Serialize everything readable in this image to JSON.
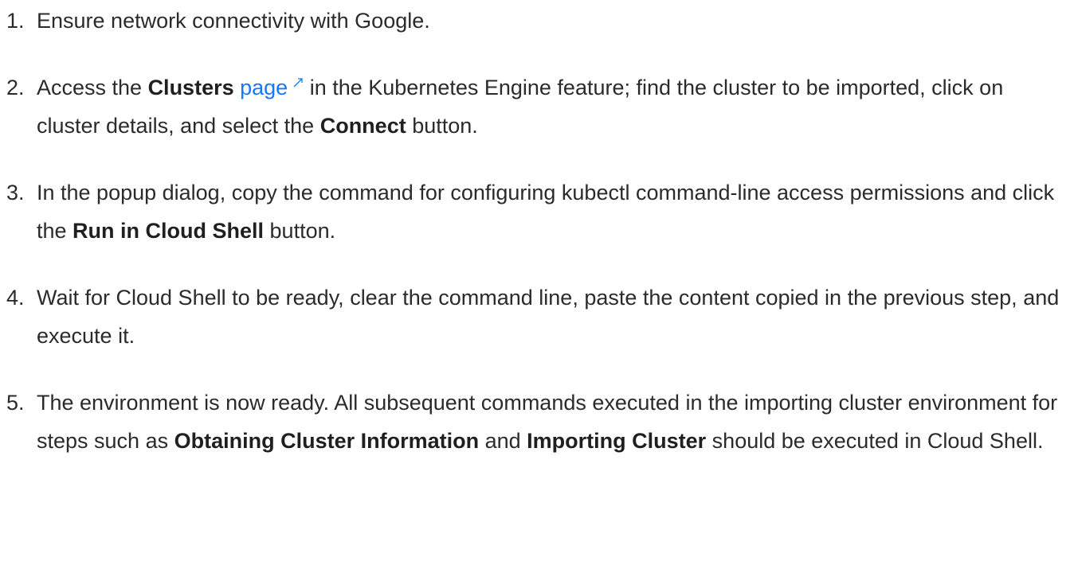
{
  "steps": [
    {
      "number": "1.",
      "text": "Ensure network connectivity with Google."
    },
    {
      "number": "2.",
      "pre": "Access the ",
      "bold1": "Clusters",
      "link": "page",
      "mid": " in the Kubernetes Engine feature; find the cluster to be imported, click on cluster details, and select the ",
      "bold2": "Connect",
      "post": " button."
    },
    {
      "number": "3.",
      "pre": "In the popup dialog, copy the command for configuring kubectl command-line access permissions and click the ",
      "bold1": "Run in Cloud Shell",
      "post": " button."
    },
    {
      "number": "4.",
      "text": "Wait for Cloud Shell to be ready, clear the command line, paste the content copied in the previous step, and execute it."
    },
    {
      "number": "5.",
      "pre": "The environment is now ready. All subsequent commands executed in the importing cluster environment for steps such as ",
      "bold1": "Obtaining Cluster Information",
      "mid": " and ",
      "bold2": "Importing Cluster",
      "post": " should be executed in Cloud Shell."
    }
  ],
  "icons": {
    "external_link": "external-link-icon"
  },
  "colors": {
    "text": "#2b2b2b",
    "link": "#1677ff"
  }
}
